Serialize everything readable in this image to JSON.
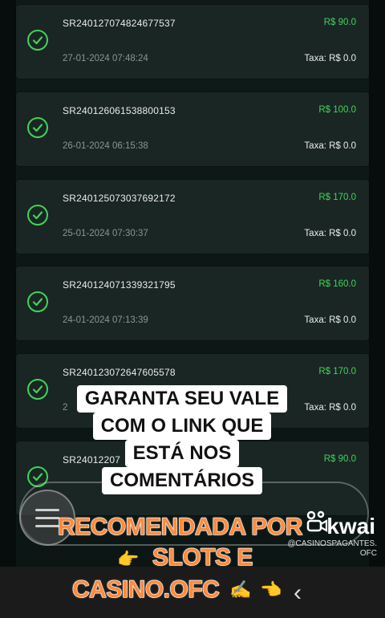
{
  "transactions": [
    {
      "ref": "SR240127074824677537",
      "date": "27-01-2024 07:48:24",
      "amount": "R$ 90.0",
      "fee": "Taxa: R$ 0.0"
    },
    {
      "ref": "SR240126061538800153",
      "date": "26-01-2024 06:15:38",
      "amount": "R$ 100.0",
      "fee": "Taxa: R$ 0.0"
    },
    {
      "ref": "SR240125073037692172",
      "date": "25-01-2024 07:30:37",
      "amount": "R$ 170.0",
      "fee": "Taxa: R$ 0.0"
    },
    {
      "ref": "SR240124071339321795",
      "date": "24-01-2024 07:13:39",
      "amount": "R$ 160.0",
      "fee": "Taxa: R$ 0.0"
    },
    {
      "ref": "SR240123072647605578",
      "date": "2",
      "amount": "R$ 170.0",
      "fee": "Taxa: R$ 0.0"
    },
    {
      "ref": "SR24012207",
      "date": "",
      "amount": "R$ 90.0",
      "fee": ""
    }
  ],
  "caption": {
    "line1": "GARANTA SEU VALE",
    "line2": "COM O LINK QUE",
    "line3": "ESTÁ NOS",
    "line4": "COMENTÁRIOS"
  },
  "promo": {
    "line1": "RECOMENDADA POR",
    "line2": "SLOTS E",
    "line3": "CASINO.OFC"
  },
  "watermark": {
    "brand": "kwai",
    "handle_line1": "@CASINOSPAGANTES.",
    "handle_line2": "OFC"
  },
  "colors": {
    "accent_green": "#3fd35a",
    "card_bg": "#1a2624",
    "promo_orange": "#ff8a3d"
  }
}
